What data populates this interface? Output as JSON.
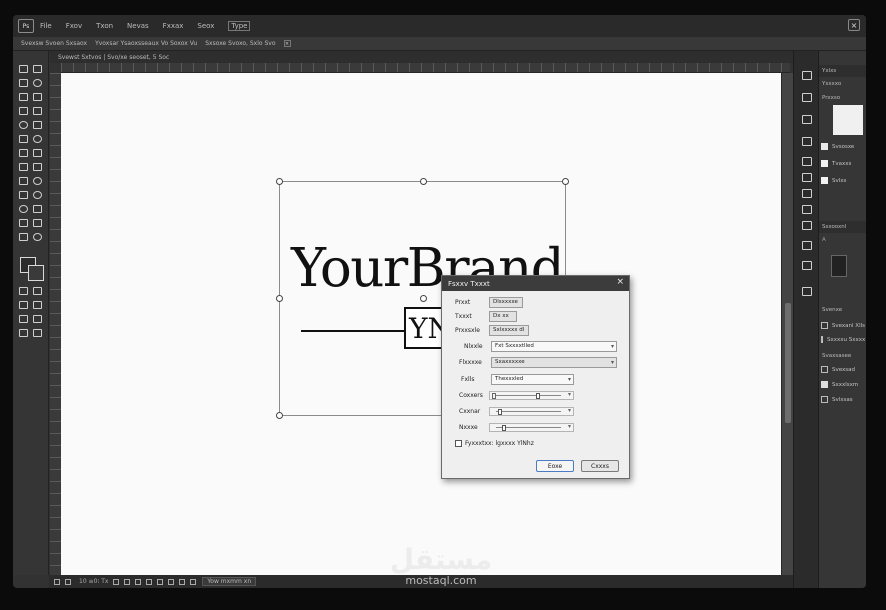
{
  "menubar": {
    "logo": "Ps",
    "items": [
      "File",
      "Fxov",
      "Txon",
      "Nevas",
      "Fxxax",
      "Seox",
      "Type"
    ],
    "active_index": 6,
    "close_glyph": "×"
  },
  "options_bar": {
    "items": [
      "Svexsw Svoen Sxsaox",
      "Yvoxsar Ysaoxsseaux Vo Soxox Vu",
      "Sxsoxe Svoxo, Sxlo Svo"
    ],
    "close_glyph": "×"
  },
  "document_tab": {
    "label": "Svewst Sxtvos | Svo/xe seoset, 5 Soc"
  },
  "canvas": {
    "brand_text": "YourBrand",
    "monogram_text": "YN"
  },
  "status_bar": {
    "text": "10 ≡0⁝ Tx",
    "field": "Yow mxmm xn"
  },
  "panels": {
    "top_tab": "Yxlxs",
    "swatch_head": "Yxsxxo",
    "preset_label": "Prxxso",
    "preset_rows": [
      "Svsosxe",
      "Tvaxxs",
      "Svlxs"
    ],
    "adjust_head": "Ssxooxnl",
    "layers_label": "Svenxe",
    "layer_rows": [
      "Svexanl Xlls",
      "Sxxxxu Sxxxx"
    ],
    "fx_label": "Svaxsasee",
    "fx_rows": [
      "Svexsad",
      "Sxxxlsxm",
      "Svlxsas"
    ],
    "accent_blue": "#4b7bc4"
  },
  "dialog": {
    "title": "Fsxxv Txxxt",
    "close_glyph": "×",
    "rows": [
      {
        "label": "Prxxt",
        "value": "Dlsxxxxe"
      },
      {
        "label": "Txxxt",
        "value": "Dx xx"
      },
      {
        "label": "Prxxsxle",
        "value": "Sxlxxxxx dl"
      },
      {
        "label": "Nlxxle",
        "value": "Fxt Sxxxxtlled"
      },
      {
        "label": "Flxxxxe",
        "value": "Sxaxxxxxe"
      },
      {
        "label": "Fxlls",
        "value": "Thexxxled"
      },
      {
        "label": "Coxxers",
        "value": ""
      },
      {
        "label": "Cxxnar",
        "value": ""
      },
      {
        "label": "Nxxxe",
        "value": ""
      }
    ],
    "checkbox_label": "Fyxxxtxx: lgxxxx YlNhz",
    "ok_label": "Eoxe",
    "cancel_label": "Cxxxs"
  },
  "watermark": {
    "logo": "مستقل",
    "text": "mostaql.com"
  }
}
